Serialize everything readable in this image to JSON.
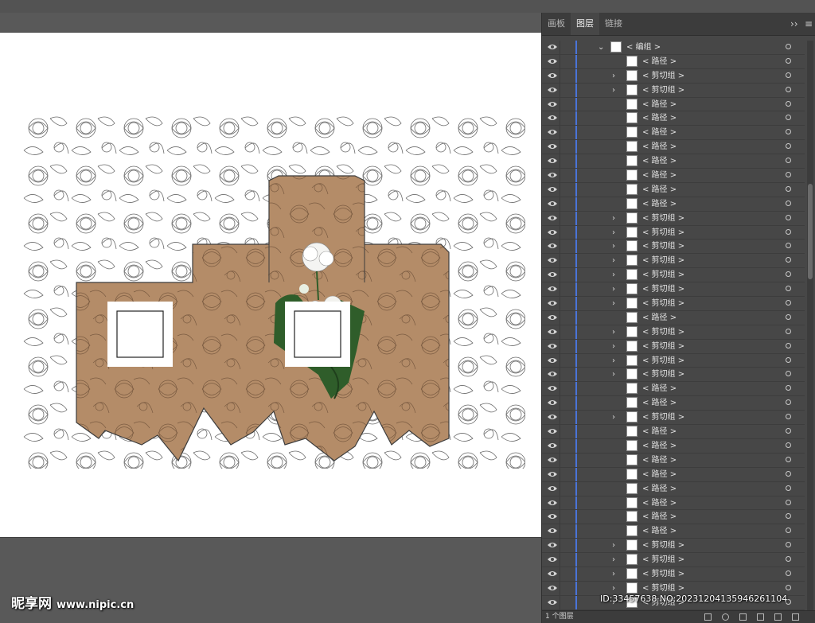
{
  "panel": {
    "tabs": [
      {
        "label": "画板",
        "active": false
      },
      {
        "label": "图层",
        "active": true
      },
      {
        "label": "链接",
        "active": false
      }
    ],
    "expand_glyph": "››",
    "menu_glyph": "≡",
    "layer_count": "1 个图层"
  },
  "layers": {
    "header": {
      "label": "< 编组 >"
    },
    "rows": [
      {
        "label": "< 路径 >",
        "expand": false
      },
      {
        "label": "< 剪切组 >",
        "expand": true
      },
      {
        "label": "< 剪切组 >",
        "expand": true
      },
      {
        "label": "< 路径 >",
        "expand": false
      },
      {
        "label": "< 路径 >",
        "expand": false
      },
      {
        "label": "< 路径 >",
        "expand": false
      },
      {
        "label": "< 路径 >",
        "expand": false
      },
      {
        "label": "< 路径 >",
        "expand": false
      },
      {
        "label": "< 路径 >",
        "expand": false
      },
      {
        "label": "< 路径 >",
        "expand": false
      },
      {
        "label": "< 路径 >",
        "expand": false
      },
      {
        "label": "< 剪切组 >",
        "expand": true
      },
      {
        "label": "< 剪切组 >",
        "expand": true
      },
      {
        "label": "< 剪切组 >",
        "expand": true
      },
      {
        "label": "< 剪切组 >",
        "expand": true
      },
      {
        "label": "< 剪切组 >",
        "expand": true
      },
      {
        "label": "< 剪切组 >",
        "expand": true
      },
      {
        "label": "< 剪切组 >",
        "expand": true
      },
      {
        "label": "< 路径 >",
        "expand": false
      },
      {
        "label": "< 剪切组 >",
        "expand": true
      },
      {
        "label": "< 剪切组 >",
        "expand": true
      },
      {
        "label": "< 剪切组 >",
        "expand": true
      },
      {
        "label": "< 剪切组 >",
        "expand": true
      },
      {
        "label": "< 路径 >",
        "expand": false
      },
      {
        "label": "< 路径 >",
        "expand": false
      },
      {
        "label": "< 剪切组 >",
        "expand": true
      },
      {
        "label": "< 路径 >",
        "expand": false
      },
      {
        "label": "< 路径 >",
        "expand": false
      },
      {
        "label": "< 路径 >",
        "expand": false
      },
      {
        "label": "< 路径 >",
        "expand": false
      },
      {
        "label": "< 路径 >",
        "expand": false
      },
      {
        "label": "< 路径 >",
        "expand": false
      },
      {
        "label": "< 路径 >",
        "expand": false
      },
      {
        "label": "< 路径 >",
        "expand": false
      },
      {
        "label": "< 剪切组 >",
        "expand": true
      },
      {
        "label": "< 剪切组 >",
        "expand": true
      },
      {
        "label": "< 剪切组 >",
        "expand": true
      },
      {
        "label": "< 剪切组 >",
        "expand": true
      },
      {
        "label": "< 剪切组 >",
        "expand": true
      }
    ]
  },
  "colors": {
    "kraft": "#b48c68",
    "layer_color": "#4a74d8",
    "panel_bg": "#474747"
  },
  "watermark": {
    "brand": "昵享网",
    "site": "www.nipic.cn",
    "id_text": "ID:33457638 NO:20231204135946261104"
  }
}
